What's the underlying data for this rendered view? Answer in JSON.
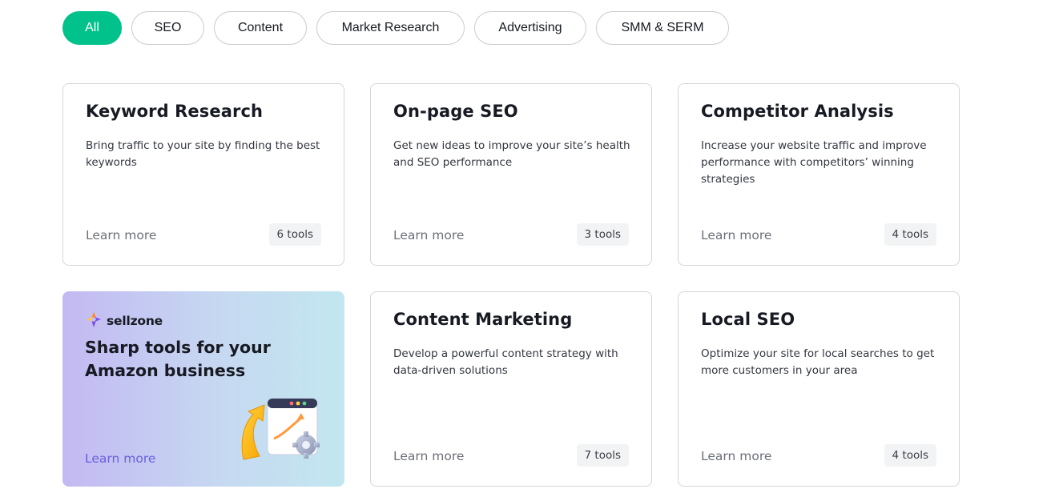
{
  "filters": [
    {
      "label": "All",
      "active": true
    },
    {
      "label": "SEO",
      "active": false
    },
    {
      "label": "Content",
      "active": false
    },
    {
      "label": "Market Research",
      "active": false
    },
    {
      "label": "Advertising",
      "active": false
    },
    {
      "label": "SMM & SERM",
      "active": false
    }
  ],
  "cards": [
    {
      "title": "Keyword Research",
      "desc": "Bring traffic to your site by finding the best keywords",
      "link": "Learn more",
      "badge": "6 tools"
    },
    {
      "title": "On-page SEO",
      "desc": "Get new ideas to improve your site’s health and SEO performance",
      "link": "Learn more",
      "badge": "3 tools"
    },
    {
      "title": "Competitor Analysis",
      "desc": "Increase your website traffic and improve performance with competitors’ winning strategies",
      "link": "Learn more",
      "badge": "4 tools"
    },
    {
      "title": "Content Marketing",
      "desc": "Develop a powerful content strategy with data-driven solutions",
      "link": "Learn more",
      "badge": "7 tools"
    },
    {
      "title": "Local SEO",
      "desc": "Optimize your site for local searches to get more customers in your area",
      "link": "Learn more",
      "badge": "4 tools"
    }
  ],
  "promo": {
    "logo": "sellzone",
    "title": "Sharp tools for your Amazon business",
    "link": "Learn more"
  },
  "colors": {
    "accent": "#00c28a",
    "promo_link": "#6a5fe0"
  },
  "icons": {
    "promo_logo": "sellzone-logo-icon",
    "promo_illustration": "growth-arrow-browser-gear-icon"
  }
}
